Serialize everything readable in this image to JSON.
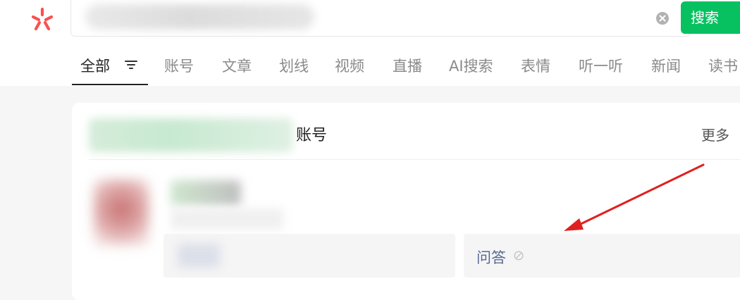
{
  "search": {
    "button_label": "搜索"
  },
  "tabs": [
    {
      "label": "全部",
      "active": true
    },
    {
      "label": "账号"
    },
    {
      "label": "文章"
    },
    {
      "label": "划线"
    },
    {
      "label": "视频"
    },
    {
      "label": "直播"
    },
    {
      "label": "AI搜索"
    },
    {
      "label": "表情"
    },
    {
      "label": "听一听"
    },
    {
      "label": "新闻"
    },
    {
      "label": "读书"
    }
  ],
  "account_card": {
    "title": "账号",
    "more_label": "更多",
    "qa_label": "问答"
  },
  "colors": {
    "brand_green": "#07c160",
    "logo_red": "#fa5151",
    "link_blue": "#576b95",
    "annotation_red": "#e02020"
  },
  "icons": [
    "logo-icon",
    "clear-icon",
    "filter-icon",
    "info-icon",
    "annotation-arrow"
  ]
}
